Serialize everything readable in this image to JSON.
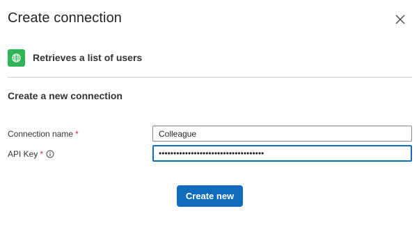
{
  "dialog": {
    "title": "Create connection",
    "close_icon": "close-icon"
  },
  "action": {
    "icon": "globe-icon",
    "icon_color": "#2fb457",
    "label": "Retrieves a list of users"
  },
  "form": {
    "section_title": "Create a new connection",
    "connection_name": {
      "label": "Connection name",
      "required_marker": "*",
      "value": "Colleague"
    },
    "api_key": {
      "label": "API Key",
      "required_marker": "*",
      "info_icon": "info-icon",
      "value": "••••••••••••••••••••••••••••••••••••"
    },
    "submit_label": "Create new"
  },
  "colors": {
    "accent": "#0f6cbd",
    "required": "#c4314b",
    "divider": "#d1d1d1"
  }
}
